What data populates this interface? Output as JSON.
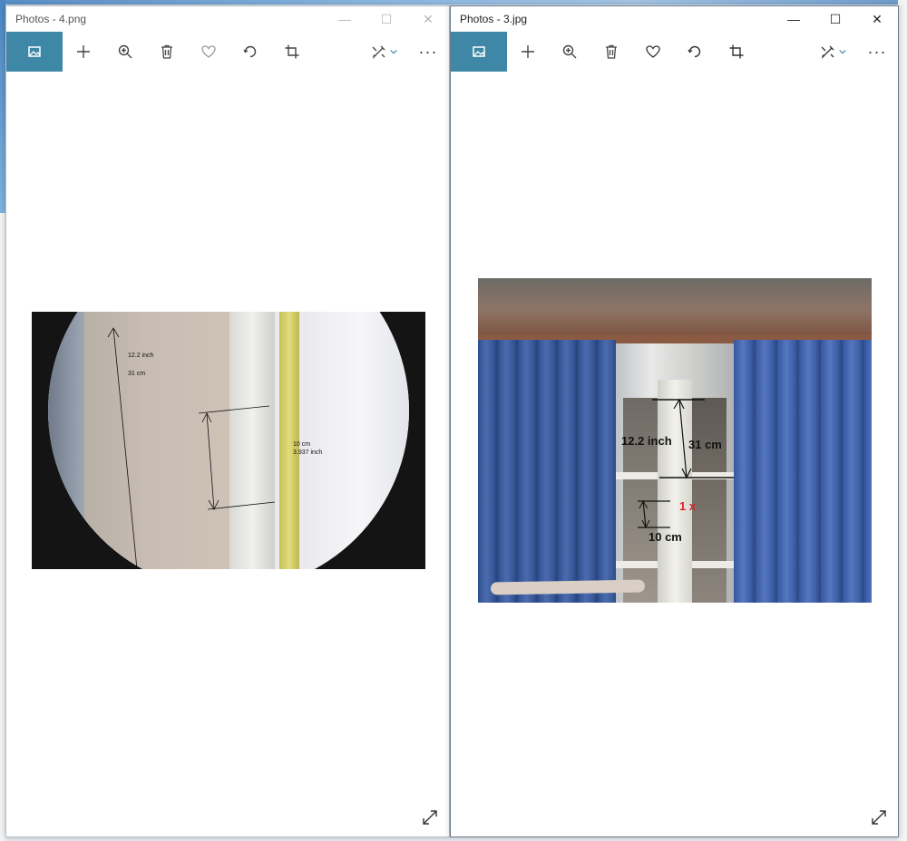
{
  "windows": [
    {
      "title": "Photos - 4.png",
      "active": false,
      "photo": {
        "annotations": {
          "height_inch": "12.2 inch",
          "height_cm": "31 cm",
          "ref_cm": "10 cm",
          "ref_inch": "3.937 inch"
        }
      }
    },
    {
      "title": "Photos - 3.jpg",
      "active": true,
      "photo": {
        "annotations": {
          "height_inch": "12.2 inch",
          "height_cm": "31 cm",
          "factor": "1 x",
          "ref_cm": "10 cm"
        }
      }
    }
  ],
  "controls": {
    "minimize": "—",
    "maximize": "☐",
    "close": "✕"
  },
  "toolbar": {
    "more": "···",
    "icons": [
      "image-icon",
      "plus-icon",
      "zoom-in-icon",
      "trash-icon",
      "heart-icon",
      "rotate-icon",
      "crop-icon",
      "edit-icon",
      "chevron-down-icon",
      "more-icon"
    ]
  },
  "colors": {
    "active_tab": "#3f87a6",
    "annotation_red": "#d8202a"
  }
}
